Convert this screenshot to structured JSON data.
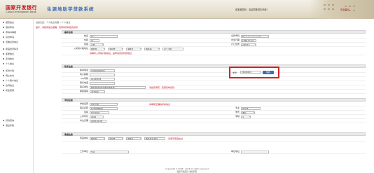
{
  "header": {
    "logo_cn": "国家开发银行",
    "logo_en": "China Development Bank",
    "system_title": "生源地助学贷款系统",
    "user_info": "张某某您好，欢迎您登录本系统！",
    "logout": "安全退出"
  },
  "sidebar": {
    "items": [
      "首页信息",
      "借款申请",
      "申请书填报",
      "贷款申请",
      "查看贷款信息",
      "家庭经济情况",
      "变更信息",
      "还款信息",
      "个人信息",
      "还款计划",
      "网上支付",
      "个人账户信息",
      "合同信息",
      "修改密码",
      "贷款查询",
      "退出系统"
    ]
  },
  "breadcrumb": "当前位置：个人信息管理 > 个人信息",
  "notice": "提示：请核实信息准确，否则将影响您的贷款",
  "sections": {
    "basic": {
      "title": "基本信息",
      "name_label": "姓名",
      "name_value": "张三",
      "id_label": "证件号码",
      "id_value": "6****************X",
      "gender_label": "性别",
      "gender_value": "男",
      "birth_label": "出生日期",
      "birth_value": "1998-07-01",
      "nation_label": "民族",
      "nation_value": "汉族",
      "hukou_label": "户口性质",
      "hukou_value": "农村户口",
      "address_label": "入学前户籍地址",
      "province": "陕西省",
      "city": "渭南市",
      "county": "蒲城县",
      "town": "城关镇",
      "village": "第二小组",
      "address_note": "请填写入学前户籍地址，是申请贷款时的地址"
    },
    "contact": {
      "title": "联系信息",
      "mobile_label": "移动电话",
      "mobile_value": "13900000000",
      "email_label": "电子邮箱",
      "email_value": "",
      "qq_label": "QQ号码",
      "qq_value": "12345678",
      "phone_label": "联系电话",
      "phone_value": "",
      "contact_addr_label": "联系地址",
      "contact_addr_value": "陕西省渭南市蒲城县城关镇",
      "postal_label": "邮政编码",
      "postal_value": "715500",
      "highlight_label": "学号",
      "highlight_value": "20160001",
      "highlight_button": "保存",
      "note": "请如实填写，否则影响贷款"
    },
    "school": {
      "title": "学校信息",
      "school_label": "学校名称",
      "school_value": "西北大学",
      "college_label": "院系名称",
      "college_value": "经济管理学院",
      "major_label": "专业",
      "major_value": "会计学",
      "class_label": "班级",
      "class_value": "会计1601",
      "degree_label": "学历",
      "degree_value": "本科",
      "enroll_label": "入学年份",
      "enroll_value": "2016",
      "length_label": "学制",
      "length_value": "4",
      "grad_label": "毕业日期",
      "grad_value": "2020-06-30",
      "note": "请填写正确的学校信息"
    },
    "family": {
      "title": "家庭信息",
      "home_label": "家庭地址",
      "province": "陕西省",
      "city": "渭南市",
      "county": "蒲城县",
      "detail": "城关镇某某村",
      "note": "请填写家庭住址",
      "work_label": "工作单位",
      "work_value": "务农",
      "work_note": "单位地址"
    }
  },
  "footer": {
    "line1": "Copyright © 2006 - 2016 All rights reserved",
    "line2": "国家开发银行 版权所有"
  }
}
